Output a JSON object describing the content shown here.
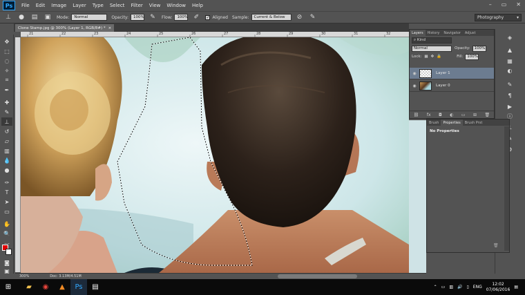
{
  "app": {
    "logo": "Ps"
  },
  "menu": [
    "File",
    "Edit",
    "Image",
    "Layer",
    "Type",
    "Select",
    "Filter",
    "View",
    "Window",
    "Help"
  ],
  "window_controls": [
    "–",
    "▭",
    "✕"
  ],
  "options": {
    "mode_label": "Mode:",
    "mode_value": "Normal",
    "opacity_label": "Opacity:",
    "opacity_value": "100%",
    "flow_label": "Flow:",
    "flow_value": "100%",
    "aligned_label": "Aligned",
    "sample_label": "Sample:",
    "sample_value": "Current & Below",
    "workspace": "Photography"
  },
  "document": {
    "tab_title": "Clone Stamp.jpg @ 300% (Layer 1, RGB/8#) *",
    "zoom": "300%",
    "doc_size": "Doc: 3.13M/4.51M"
  },
  "ruler_labels": [
    "21",
    "22",
    "23",
    "24",
    "25",
    "26",
    "27",
    "28",
    "29",
    "30",
    "31",
    "32"
  ],
  "layers": {
    "tabs": [
      "Layers",
      "History",
      "Navigator",
      "Adjust"
    ],
    "kind_label": "Kind",
    "blend_mode": "Normal",
    "opacity_label": "Opacity:",
    "opacity_value": "100%",
    "lock_label": "Lock:",
    "fill_label": "Fill:",
    "fill_value": "100%",
    "items": [
      {
        "name": "Layer 1"
      },
      {
        "name": "Layer 0"
      }
    ]
  },
  "properties": {
    "tabs": [
      "Brush",
      "Properties",
      "Brush Prst"
    ],
    "empty_text": "No Properties"
  },
  "taskbar": {
    "language": "ENG",
    "time": "12:02",
    "date": "07/06/2016"
  },
  "colors": {
    "foreground": "#e00000",
    "background": "#ffffff",
    "panel": "#535353"
  }
}
